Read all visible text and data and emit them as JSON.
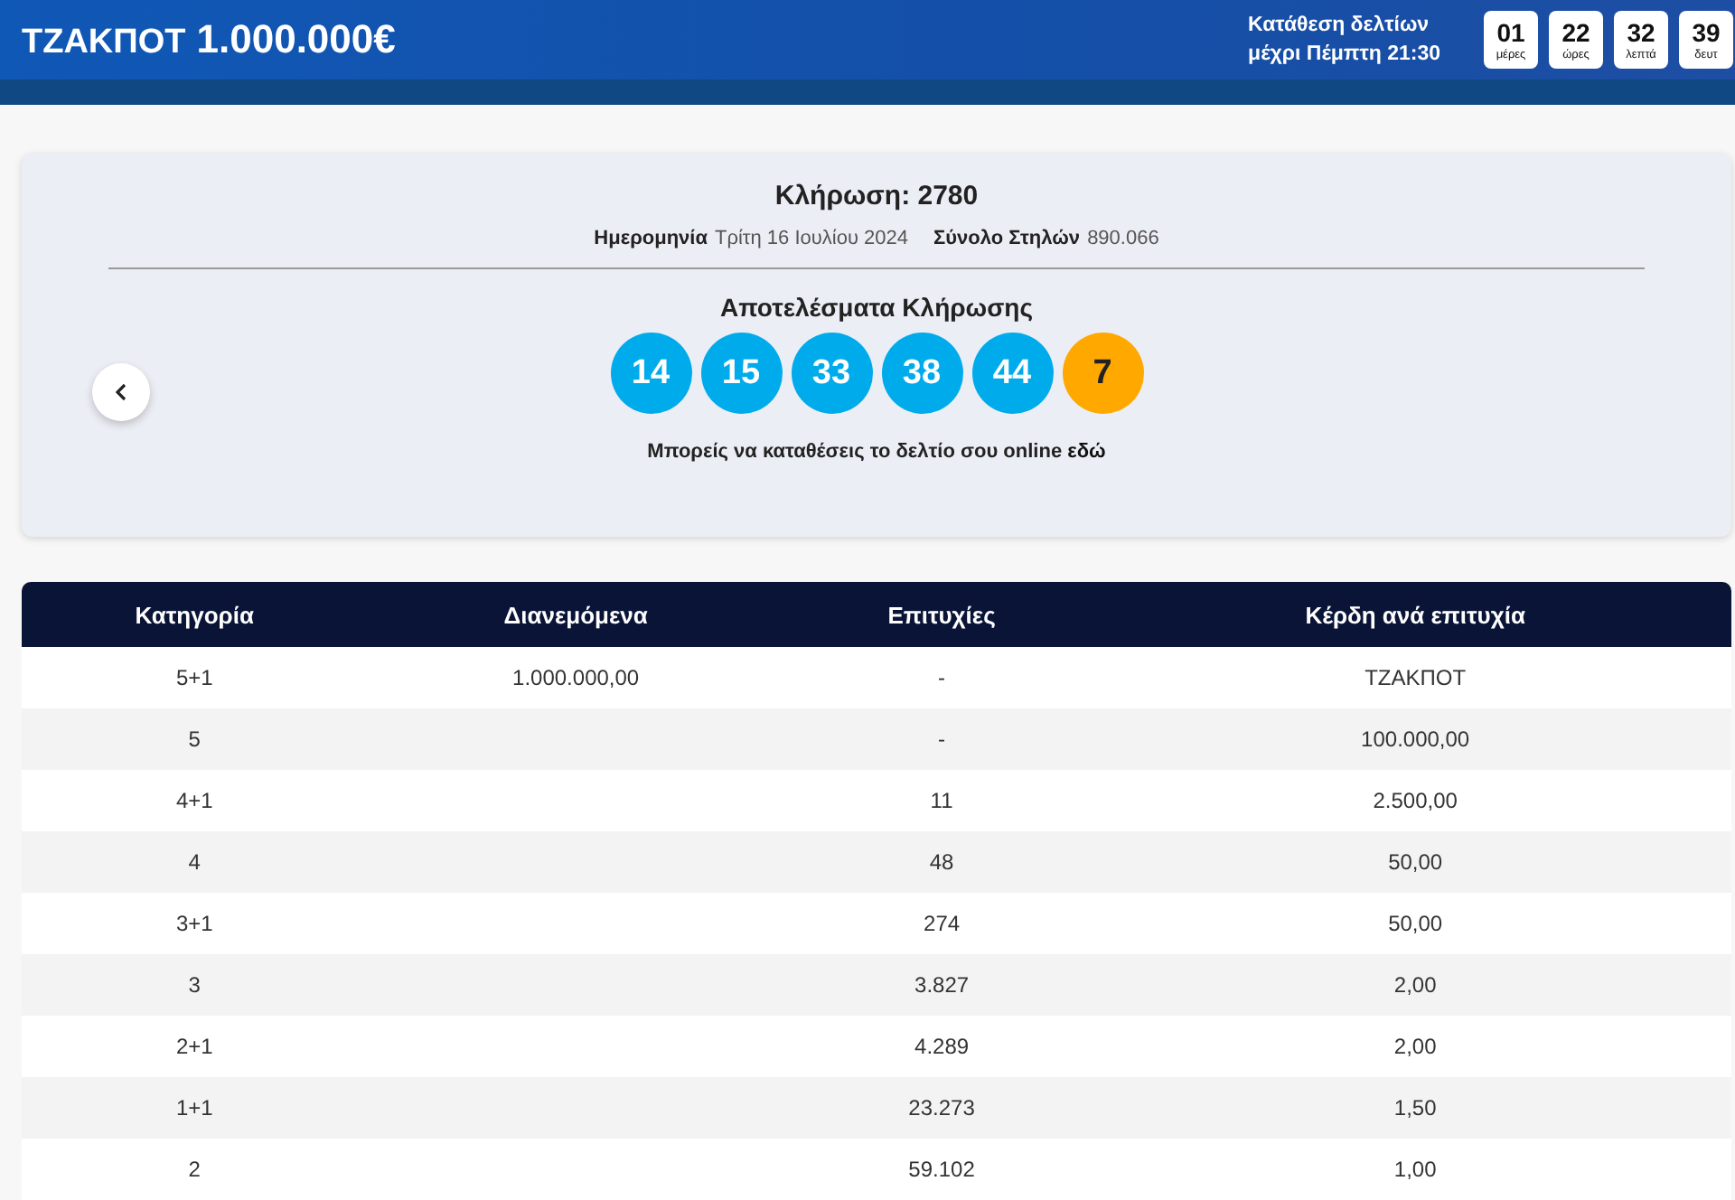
{
  "header": {
    "jackpot_label": "ΤΖΑΚΠΟΤ",
    "jackpot_amount": "1.000.000€",
    "deadline_line1": "Κατάθεση δελτίων",
    "deadline_line2": "μέχρι Πέμπτη 21:30",
    "countdown": [
      {
        "value": "01",
        "unit": "μέρες"
      },
      {
        "value": "22",
        "unit": "ώρες"
      },
      {
        "value": "32",
        "unit": "λεπτά"
      },
      {
        "value": "39",
        "unit": "δευτ"
      }
    ]
  },
  "draw": {
    "title": "Κλήρωση: 2780",
    "date_label": "Ημερομηνία",
    "date_value": "Τρίτη 16 Ιουλίου 2024",
    "columns_label": "Σύνολο Στηλών",
    "columns_value": "890.066",
    "results_title": "Αποτελέσματα Κλήρωσης",
    "balls": [
      {
        "number": "14",
        "kind": "main"
      },
      {
        "number": "15",
        "kind": "main"
      },
      {
        "number": "33",
        "kind": "main"
      },
      {
        "number": "38",
        "kind": "main"
      },
      {
        "number": "44",
        "kind": "main"
      },
      {
        "number": "7",
        "kind": "bonus"
      }
    ],
    "note": "Μπορείς να καταθέσεις το δελτίο σου online",
    "note_link": "εδώ"
  },
  "table": {
    "columns": [
      "Κατηγορία",
      "Διανεμόμενα",
      "Επιτυχίες",
      "Κέρδη ανά επιτυχία"
    ],
    "rows": [
      [
        "5+1",
        "1.000.000,00",
        "-",
        "ΤΖΑΚΠΟΤ"
      ],
      [
        "5",
        "",
        "-",
        "100.000,00"
      ],
      [
        "4+1",
        "",
        "11",
        "2.500,00"
      ],
      [
        "4",
        "",
        "48",
        "50,00"
      ],
      [
        "3+1",
        "",
        "274",
        "50,00"
      ],
      [
        "3",
        "",
        "3.827",
        "2,00"
      ],
      [
        "2+1",
        "",
        "4.289",
        "2,00"
      ],
      [
        "1+1",
        "",
        "23.273",
        "1,50"
      ],
      [
        "2",
        "",
        "59.102",
        "1,00"
      ]
    ]
  }
}
